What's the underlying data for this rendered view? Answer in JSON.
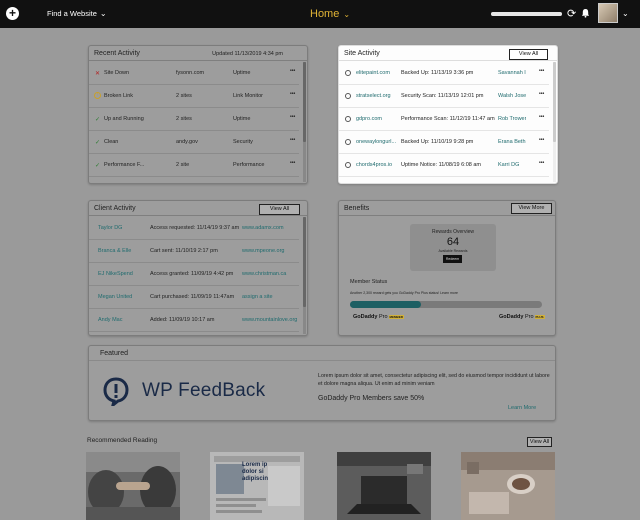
{
  "topbar": {
    "add_icon": "plus-circle-icon",
    "site_selector": "Find a Website",
    "page_title": "Home",
    "sync_icon": "sync-icon",
    "bell_icon": "bell-icon",
    "progress": 1.0
  },
  "recent_activity": {
    "title": "Recent Activity",
    "updated": "Updated 11/13/2019 4:34 pm",
    "rows": [
      {
        "status_icon": "x-icon",
        "status_color": "#b22222",
        "event": "Site Down",
        "count": "fysonn.com",
        "source": "Uptime"
      },
      {
        "status_icon": "warning-circle-icon",
        "status_color": "#c9a02a",
        "event": "Broken Link",
        "count": "2 sites",
        "source": "Link Monitor"
      },
      {
        "status_icon": "check-icon",
        "status_color": "#2e7d32",
        "event": "Up and Running",
        "count": "2 sites",
        "source": "Uptime"
      },
      {
        "status_icon": "check-icon",
        "status_color": "#2e7d32",
        "event": "Clean",
        "count": "andy.gov",
        "source": "Security"
      },
      {
        "status_icon": "check-icon",
        "status_color": "#2e7d32",
        "event": "Performance F...",
        "count": "2 site",
        "source": "Performance"
      }
    ]
  },
  "site_activity": {
    "title": "Site Activity",
    "view_all": "View All",
    "rows": [
      {
        "site": "elitepaint.com",
        "event": "Backed Up: 11/13/19 3:36 pm",
        "user": "Savannah I."
      },
      {
        "site": "stratselect.org",
        "event": "Security Scan: 11/13/19 12:01 pm",
        "user": "Walsh Joseph"
      },
      {
        "site": "gdpro.com",
        "event": "Performance Scan: 11/12/19 11:47 am",
        "user": "Rob Trower"
      },
      {
        "site": "onewaylongurl...",
        "event": "Backed Up: 11/10/19 9:28 pm",
        "user": "Erana Beth"
      },
      {
        "site": "chords4pros.io",
        "event": "Uptime Notice: 11/08/19 6:08 am",
        "user": "Karri DG"
      }
    ]
  },
  "client_activity": {
    "title": "Client Activity",
    "view_all": "View All",
    "rows": [
      {
        "client": "Taylor DG",
        "event": "Access requested: 11/14/19 9:37 am",
        "site": "www.adamx.com"
      },
      {
        "client": "Branca & Elle",
        "event": "Cart sent: 11/10/19 2:17 pm",
        "site": "www.mpeone.org"
      },
      {
        "client": "EJ NikeSpend",
        "event": "Access granted: 11/09/19 4:42 pm",
        "site": "www.christman.ca"
      },
      {
        "client": "Megan United",
        "event": "Cart purchased: 11/09/19 11:47am",
        "site": "assign a site"
      },
      {
        "client": "Andy Mac",
        "event": "Added: 11/09/19 10:17 am",
        "site": "www.mountainlove.org"
      }
    ]
  },
  "benefits": {
    "title": "Benefits",
    "view_more": "View More",
    "rewards_title": "Rewards Overview",
    "rewards_count": "64",
    "rewards_label": "Available Rewards",
    "redeem": "Redeem",
    "member_status": "Member Status",
    "member_note": "Another 2,300 reward gets you GoDaddy Pro Plus status! Learn more",
    "progress": 0.37,
    "tier_left": {
      "brand": "GoDaddy",
      "tier": "Pro",
      "badge": "MEMBER"
    },
    "tier_right": {
      "brand": "GoDaddy",
      "tier": "Pro",
      "badge": "PLUS"
    }
  },
  "featured": {
    "title": "Featured",
    "logo_text": "WP FeedBack",
    "description": "Lorem ipsum dolor sit amet, consectetur adipiscing elit, sed do eiusmod tempor incididunt ut labore et dolore magna aliqua. Ut enim ad minim veniam",
    "subtitle": "GoDaddy Pro Members save 50%",
    "link": "Learn More"
  },
  "recommended": {
    "title": "Recommended Reading",
    "view_all": "View All",
    "articles": [
      {
        "image": "handshake-photo"
      },
      {
        "image": "article-screenshot",
        "text": "Lorem ip dolor si adipiscin"
      },
      {
        "image": "laptop-photo"
      },
      {
        "image": "coffee-workspace-photo"
      }
    ]
  }
}
